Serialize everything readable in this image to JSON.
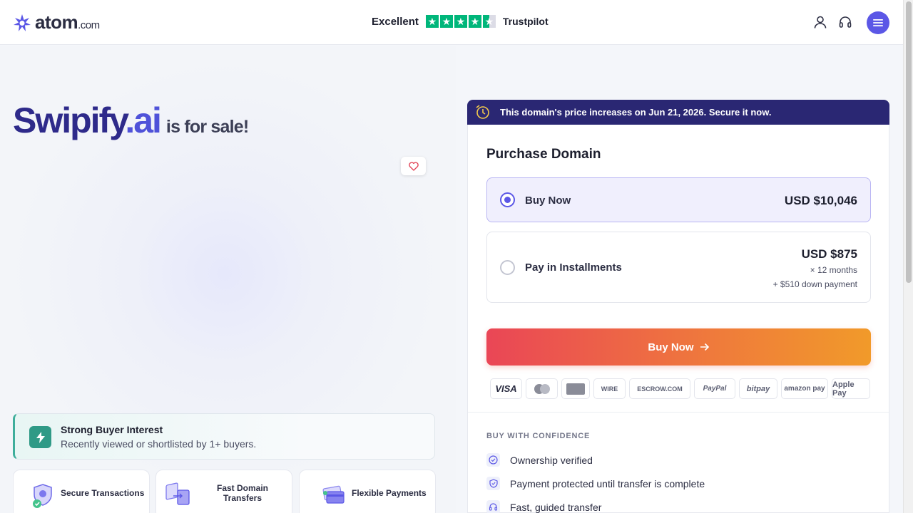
{
  "header": {
    "logo": {
      "brand": "atom",
      "suffix": ".com"
    },
    "trustpilot": {
      "rating_label": "Excellent",
      "brand": "Trustpilot",
      "stars": 4.5
    },
    "icons": [
      "user-icon",
      "headset-icon",
      "menu-icon"
    ]
  },
  "hero": {
    "domain_name": "Swipify",
    "domain_tld": ".ai",
    "for_sale_text": "is for sale!"
  },
  "interest": {
    "title": "Strong Buyer Interest",
    "subtitle": "Recently viewed or shortlisted by 1+ buyers."
  },
  "features": [
    {
      "label": "Secure Transactions",
      "icon": "shield-icon"
    },
    {
      "label": "Fast Domain Transfers",
      "icon": "transfer-icon"
    },
    {
      "label": "Flexible Payments",
      "icon": "card-icon"
    }
  ],
  "banner": {
    "text": "This domain's price increases on Jun 21, 2026. Secure it now."
  },
  "purchase": {
    "title": "Purchase Domain",
    "options": [
      {
        "label": "Buy Now",
        "price": "USD $10,046",
        "selected": true
      },
      {
        "label": "Pay in Installments",
        "price": "USD $875",
        "term": "× 12 months",
        "down": "+ $510 down payment",
        "selected": false
      }
    ],
    "cta": "Buy Now",
    "payment_methods": [
      "VISA",
      "Mastercard",
      "Amex",
      "WIRE",
      "ESCROW.COM",
      "PayPal",
      "bitpay",
      "amazon pay",
      "Apple Pay"
    ]
  },
  "confidence": {
    "heading": "BUY WITH CONFIDENCE",
    "items": [
      "Ownership verified",
      "Payment protected until transfer is complete",
      "Fast, guided transfer"
    ]
  },
  "colors": {
    "accent": "#5b57e6",
    "banner": "#2a2773",
    "cta_start": "#ea4656",
    "cta_end": "#f19a2a",
    "trustpilot": "#00b67a"
  }
}
